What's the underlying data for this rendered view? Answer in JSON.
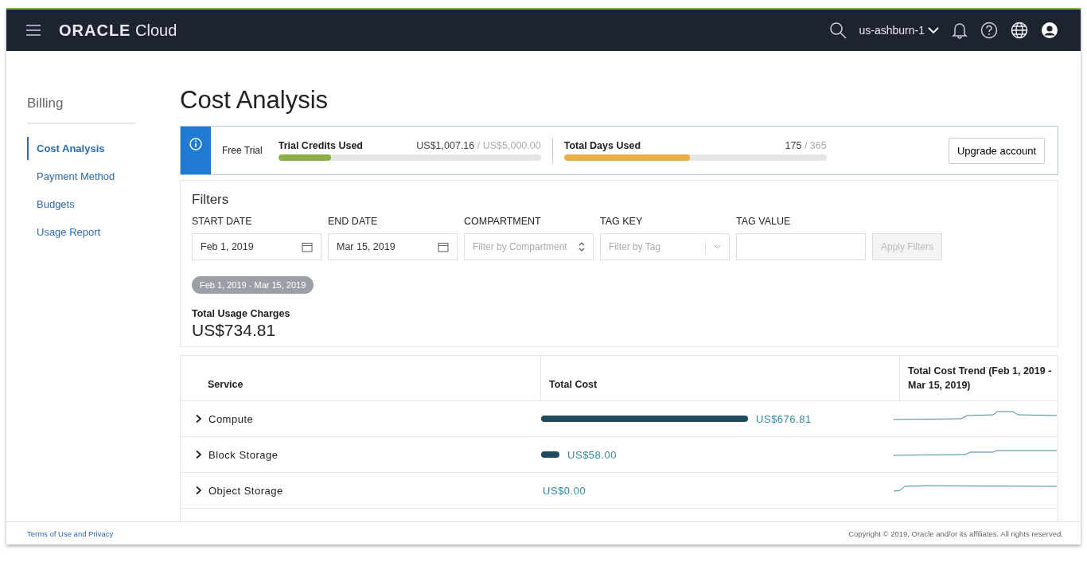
{
  "header": {
    "brand": "ORACLE",
    "product": "Cloud",
    "region": "us-ashburn-1"
  },
  "sidebar": {
    "title": "Billing",
    "items": [
      {
        "label": "Cost Analysis",
        "selected": true
      },
      {
        "label": "Payment Method",
        "selected": false
      },
      {
        "label": "Budgets",
        "selected": false
      },
      {
        "label": "Usage Report",
        "selected": false
      }
    ]
  },
  "page_title": "Cost Analysis",
  "trial_banner": {
    "label": "Free Trial",
    "meters": [
      {
        "name": "Trial Credits Used",
        "used": "US$1,007.16",
        "total": " / US$5,000.00",
        "level": 0.2,
        "color": "#8bb04a"
      },
      {
        "name": "Total Days Used",
        "used": "175",
        "total": " / 365",
        "level": 0.48,
        "color": "#eaae43"
      }
    ],
    "button": "Upgrade account"
  },
  "filters": {
    "title": "Filters",
    "fields": [
      {
        "label": "START DATE",
        "kind": "date",
        "value": "Feb 1, 2019"
      },
      {
        "label": "END DATE",
        "kind": "date",
        "value": "Mar 15, 2019"
      },
      {
        "label": "COMPARTMENT",
        "kind": "select",
        "placeholder": "Filter by Compartment"
      },
      {
        "label": "TAG KEY",
        "kind": "combo",
        "placeholder": "Filter by Tag"
      },
      {
        "label": "TAG VALUE",
        "kind": "text"
      }
    ],
    "apply_button": "Apply Filters",
    "disabled": true,
    "range_chip": "Feb 1, 2019 - Mar 15, 2019",
    "total_label": "Total Usage Charges",
    "total_value": "US$734.81"
  },
  "table": {
    "columns": [
      "Service",
      "Total Cost",
      "Total Cost Trend (Feb 1, 2019 - Mar 15, 2019)"
    ],
    "rows": [
      {
        "service": "Compute",
        "expanded": false,
        "cost": "US$676.81"
      },
      {
        "service": "Block Storage",
        "expanded": false,
        "cost": "US$58.00"
      },
      {
        "service": "Object Storage",
        "expanded": false,
        "cost": "US$0.00"
      }
    ]
  },
  "footer": {
    "link": "Terms of Use and Privacy",
    "copyright": "Copyright © 2019, Oracle and/or its affiliates. All rights reserved."
  }
}
